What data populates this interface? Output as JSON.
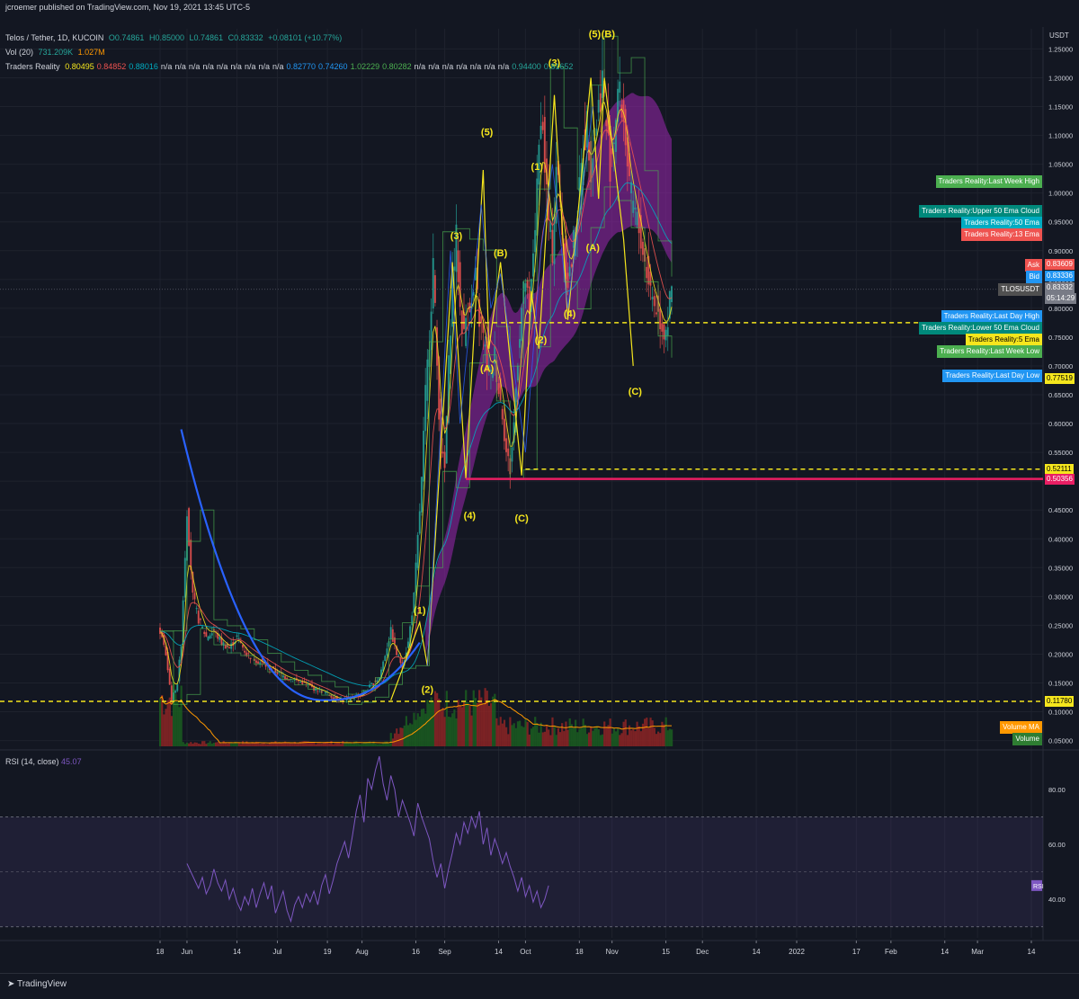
{
  "header": {
    "published": "jcroemer published on TradingView.com, Nov 19, 2021 13:45 UTC-5",
    "symbol": "Telos / Tether, 1D, KUCOIN",
    "open": "O0.74861",
    "high": "H0.85000",
    "low": "L0.74861",
    "close": "C0.83332",
    "change": "+0.08101 (+10.77%)",
    "vol_label": "Vol (20)",
    "vol_a": "731.209K",
    "vol_b": "1.027M",
    "tr_label": "Traders Reality",
    "tr_values": [
      "0.80495",
      "0.84852",
      "0.88016",
      "n/a",
      "n/a",
      "n/a",
      "n/a",
      "n/a",
      "n/a",
      "n/a",
      "n/a",
      "n/a",
      "0.82770",
      "0.74260",
      "1.02229",
      "0.80282",
      "n/a",
      "n/a",
      "n/a",
      "n/a",
      "n/a",
      "n/a",
      "n/a",
      "0.94400",
      "0.81652"
    ]
  },
  "colors": {
    "background": "#131722",
    "up": "#26a69a",
    "down": "#ef5350",
    "cup": "#2962ff",
    "wave": "#f5e61d",
    "cloud": "#9c27b0",
    "rsi": "#7e57c2"
  },
  "tags": [
    {
      "label": "Traders Reality:Last Week High",
      "color": "#4caf50",
      "price": 1.02
    },
    {
      "label": "Traders Reality:Upper 50 Ema Cloud",
      "color": "#00897b",
      "price": 0.968
    },
    {
      "label": "Traders Reality:50 Ema",
      "color": "#00acc1",
      "price": 0.948
    },
    {
      "label": "Traders Reality:13 Ema",
      "color": "#ef5350",
      "price": 0.928
    },
    {
      "label": "Traders Reality:Last Day High",
      "color": "#2196f3",
      "price": 0.785
    },
    {
      "label": "Traders Reality:Lower 50 Ema Cloud",
      "color": "#00897b",
      "price": 0.765
    },
    {
      "label": "Traders Reality:5 Ema",
      "color": "#f5e61d",
      "price": 0.745
    },
    {
      "label": "Traders Reality:Last Week Low",
      "color": "#4caf50",
      "price": 0.725
    },
    {
      "label": "Traders Reality:Last Day Low",
      "color": "#2196f3",
      "price": 0.683
    },
    {
      "label": "Volume MA",
      "color": "#ff9800",
      "price": 0.072
    },
    {
      "label": "Volume",
      "color": "#2e7d32",
      "price": 0.052
    }
  ],
  "right_tags": [
    {
      "label": "Ask",
      "color": "#ef5350",
      "price": 0.875
    },
    {
      "label": "Bid",
      "color": "#2196f3",
      "price": 0.855
    },
    {
      "label": "TLOSUSDT",
      "color": "#505050",
      "price": 0.833
    }
  ],
  "price_boxes": [
    {
      "text": "0.83609",
      "color": "#ef5350",
      "price": 0.876
    },
    {
      "text": "0.83336",
      "color": "#2196f3",
      "price": 0.856
    },
    {
      "text": "0.83332",
      "color": "#787b86",
      "price": 0.836
    },
    {
      "text": "05:14:29",
      "color": "#787b86",
      "price": 0.817
    },
    {
      "text": "0.77519",
      "color": "#f5e61d",
      "price": 0.678
    },
    {
      "text": "0.52111",
      "color": "#f5e61d",
      "price": 0.521
    },
    {
      "text": "0.50356",
      "color": "#e91e63",
      "price": 0.504
    },
    {
      "text": "0.11780",
      "color": "#f5e61d",
      "price": 0.118
    }
  ],
  "chart_data": {
    "type": "line",
    "price_axis": {
      "unit": "USDT",
      "ylim": [
        0.04,
        1.285
      ],
      "ticks": [
        "1.25000",
        "1.20000",
        "1.15000",
        "1.10000",
        "1.05000",
        "1.00000",
        "0.95000",
        "0.90000",
        "0.85000",
        "0.80000",
        "0.75000",
        "0.70000",
        "0.65000",
        "0.60000",
        "0.55000",
        "0.50000",
        "0.45000",
        "0.40000",
        "0.35000",
        "0.30000",
        "0.25000",
        "0.20000",
        "0.15000",
        "0.10000",
        "0.05000"
      ],
      "tick_values": [
        1.25,
        1.2,
        1.15,
        1.1,
        1.05,
        1.0,
        0.95,
        0.9,
        0.85,
        0.8,
        0.75,
        0.7,
        0.65,
        0.6,
        0.55,
        0.5,
        0.45,
        0.4,
        0.35,
        0.3,
        0.25,
        0.2,
        0.15,
        0.1,
        0.05
      ]
    },
    "time_axis": {
      "labels": [
        "18",
        "Jun",
        "14",
        "Jul",
        "19",
        "Aug",
        "16",
        "Sep",
        "14",
        "Oct",
        "18",
        "Nov",
        "15",
        "Dec",
        "14",
        "2022",
        "17",
        "Feb",
        "14",
        "Mar",
        "14"
      ],
      "day_index": [
        0,
        14,
        40,
        61,
        87,
        105,
        133,
        148,
        176,
        190,
        218,
        235,
        263,
        282,
        310,
        331,
        362,
        380,
        408,
        425,
        453
      ],
      "xlim": [
        0,
        453
      ]
    },
    "series": [
      {
        "name": "Traders Reality",
        "type": "close",
        "x": [
          0,
          3,
          6,
          9,
          11,
          14,
          17,
          20,
          24,
          28,
          32,
          36,
          40,
          45,
          50,
          55,
          60,
          65,
          70,
          75,
          80,
          85,
          90,
          95,
          100,
          105,
          108,
          111,
          114,
          117,
          120,
          123,
          126,
          129,
          132,
          134,
          136,
          138,
          140,
          142,
          144,
          146,
          148,
          150,
          152,
          154,
          156,
          158,
          160,
          162,
          164,
          166,
          168,
          170,
          172,
          174,
          176,
          178,
          180,
          182,
          184,
          186,
          188,
          190,
          192,
          194,
          196,
          198,
          200,
          202,
          204,
          206,
          208,
          210,
          212,
          214,
          216,
          218,
          220,
          222,
          224,
          226,
          228,
          230,
          232,
          234,
          236,
          238,
          240,
          242,
          244,
          246,
          248,
          250,
          252,
          254,
          256,
          258,
          260,
          262,
          264,
          266
        ],
        "y": [
          0.24,
          0.2,
          0.12,
          0.15,
          0.22,
          0.45,
          0.3,
          0.26,
          0.23,
          0.24,
          0.22,
          0.21,
          0.23,
          0.2,
          0.19,
          0.18,
          0.17,
          0.16,
          0.155,
          0.15,
          0.14,
          0.135,
          0.125,
          0.12,
          0.125,
          0.13,
          0.14,
          0.15,
          0.16,
          0.2,
          0.24,
          0.2,
          0.18,
          0.22,
          0.3,
          0.4,
          0.5,
          0.65,
          0.75,
          0.88,
          0.7,
          0.55,
          0.52,
          0.7,
          0.85,
          0.92,
          0.8,
          0.75,
          0.82,
          0.8,
          0.85,
          0.78,
          0.75,
          0.7,
          0.68,
          0.72,
          0.66,
          0.62,
          0.55,
          0.52,
          0.6,
          0.72,
          0.8,
          0.85,
          0.78,
          0.9,
          1.0,
          1.15,
          1.05,
          0.95,
          0.9,
          1.05,
          0.98,
          0.9,
          0.85,
          0.88,
          0.95,
          1.0,
          1.08,
          1.12,
          1.05,
          1.1,
          1.15,
          1.2,
          1.12,
          1.05,
          1.1,
          1.18,
          1.15,
          1.1,
          1.0,
          0.98,
          0.95,
          0.92,
          0.88,
          0.85,
          0.82,
          0.8,
          0.78,
          0.76,
          0.78,
          0.833
        ]
      },
      {
        "name": "Volume",
        "type": "volume"
      }
    ],
    "annotations": [
      {
        "text": "(1)",
        "x": 135,
        "y": 0.27
      },
      {
        "text": "(2)",
        "x": 139,
        "y": 0.133
      },
      {
        "text": "(3)",
        "x": 154,
        "y": 0.92
      },
      {
        "text": "(4)",
        "x": 161,
        "y": 0.435
      },
      {
        "text": "(5)",
        "x": 170,
        "y": 1.1
      },
      {
        "text": "(A)",
        "x": 170,
        "y": 0.69
      },
      {
        "text": "(B)",
        "x": 177,
        "y": 0.89
      },
      {
        "text": "(C)",
        "x": 188,
        "y": 0.43
      },
      {
        "text": "(1)",
        "x": 196,
        "y": 1.04
      },
      {
        "text": "(2)",
        "x": 198,
        "y": 0.74
      },
      {
        "text": "(3)",
        "x": 205,
        "y": 1.22
      },
      {
        "text": "(4)",
        "x": 213,
        "y": 0.785
      },
      {
        "text": "(5)",
        "x": 226,
        "y": 1.27
      },
      {
        "text": "(B)",
        "x": 233,
        "y": 1.27
      },
      {
        "text": "(A)",
        "x": 225,
        "y": 0.9
      },
      {
        "text": "(C)",
        "x": 247,
        "y": 0.65
      }
    ],
    "rsi": {
      "label": "RSI (14, close)",
      "value": "45.07",
      "tag": "RSI",
      "ylim": [
        26,
        93
      ],
      "ticks": [
        "80.00",
        "60.00",
        "40.00"
      ],
      "tick_values": [
        80,
        60,
        40
      ],
      "band": [
        30,
        70
      ],
      "x": [
        14,
        16,
        18,
        20,
        22,
        24,
        26,
        28,
        30,
        32,
        34,
        36,
        38,
        40,
        42,
        44,
        46,
        48,
        50,
        52,
        54,
        56,
        58,
        60,
        62,
        64,
        66,
        68,
        70,
        72,
        74,
        76,
        78,
        80,
        82,
        84,
        86,
        88,
        90,
        92,
        94,
        96,
        98,
        100,
        102,
        104,
        106,
        108,
        110,
        112,
        114,
        116,
        118,
        120,
        122,
        124,
        126,
        128,
        130,
        132,
        134,
        136,
        138,
        140,
        142,
        144,
        146,
        148,
        150,
        152,
        154,
        156,
        158,
        160,
        162,
        164,
        166,
        168,
        170,
        172,
        174,
        176,
        178,
        180,
        182,
        184,
        186,
        188,
        190,
        192,
        194,
        196,
        198,
        200,
        202,
        204,
        206,
        208,
        210,
        212,
        214,
        216,
        218,
        220,
        222,
        224,
        226,
        228,
        230,
        232,
        234,
        236,
        238,
        240,
        242,
        244,
        246,
        248,
        250,
        252
      ],
      "y": [
        53,
        50,
        47,
        44,
        48,
        42,
        45,
        51,
        46,
        43,
        47,
        40,
        44,
        39,
        36,
        41,
        38,
        44,
        37,
        42,
        46,
        40,
        45,
        35,
        39,
        43,
        36,
        32,
        38,
        41,
        37,
        42,
        39,
        43,
        38,
        45,
        49,
        42,
        47,
        53,
        57,
        61,
        55,
        63,
        72,
        78,
        68,
        84,
        80,
        87,
        92,
        82,
        76,
        85,
        80,
        70,
        76,
        72,
        68,
        63,
        75,
        70,
        66,
        62,
        54,
        48,
        53,
        44,
        51,
        57,
        64,
        60,
        68,
        64,
        70,
        66,
        72,
        60,
        66,
        56,
        62,
        58,
        53,
        57,
        52,
        48,
        43,
        48,
        41,
        45,
        39,
        43,
        37,
        40,
        45
      ]
    }
  }
}
